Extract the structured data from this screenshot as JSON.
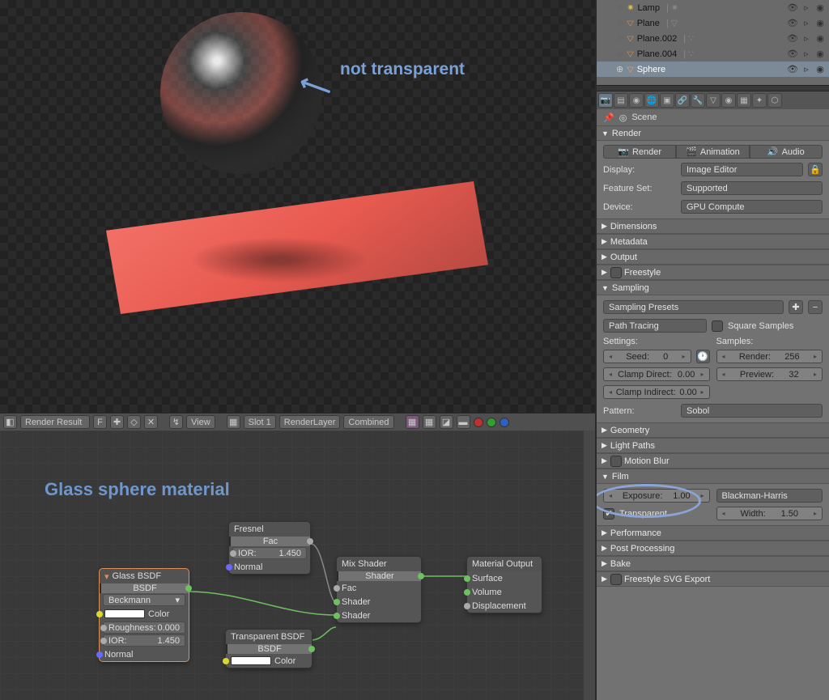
{
  "annotations": {
    "not_transparent": "not transparent",
    "material_title": "Glass sphere material"
  },
  "outliner": {
    "items": [
      {
        "name": "Lamp",
        "icon": "lamp"
      },
      {
        "name": "Plane",
        "icon": "mesh"
      },
      {
        "name": "Plane.002",
        "icon": "mesh"
      },
      {
        "name": "Plane.004",
        "icon": "mesh"
      },
      {
        "name": "Sphere",
        "icon": "mesh",
        "selected": true
      }
    ]
  },
  "image_header": {
    "result": "Render Result",
    "result_key": "F",
    "view": "View",
    "slot": "Slot 1",
    "layer": "RenderLayer",
    "pass": "Combined"
  },
  "nodes": {
    "glass": {
      "title": "Glass BSDF",
      "out": "BSDF",
      "dist": "Beckmann",
      "color": "Color",
      "rough_l": "Roughness:",
      "rough_v": "0.000",
      "ior_l": "IOR:",
      "ior_v": "1.450",
      "normal": "Normal"
    },
    "fresnel": {
      "title": "Fresnel",
      "out": "Fac",
      "ior_l": "IOR:",
      "ior_v": "1.450",
      "normal": "Normal"
    },
    "transp": {
      "title": "Transparent BSDF",
      "out": "BSDF",
      "color": "Color"
    },
    "mix": {
      "title": "Mix Shader",
      "out": "Shader",
      "fac": "Fac",
      "sh1": "Shader",
      "sh2": "Shader"
    },
    "mat": {
      "title": "Material Output",
      "surf": "Surface",
      "vol": "Volume",
      "disp": "Displacement"
    }
  },
  "props": {
    "crumb": "Scene",
    "render": {
      "title": "Render",
      "render": "Render",
      "anim": "Animation",
      "audio": "Audio",
      "display_l": "Display:",
      "display_v": "Image Editor",
      "feat_l": "Feature Set:",
      "feat_v": "Supported",
      "dev_l": "Device:",
      "dev_v": "GPU Compute"
    },
    "collapsed": [
      "Dimensions",
      "Metadata",
      "Output",
      "Freestyle"
    ],
    "sampling": {
      "title": "Sampling",
      "presets": "Sampling Presets",
      "integrator": "Path Tracing",
      "square": "Square Samples",
      "settings": "Settings:",
      "samples": "Samples:",
      "seed_l": "Seed:",
      "seed_v": "0",
      "render_l": "Render:",
      "render_v": "256",
      "cd_l": "Clamp Direct:",
      "cd_v": "0.00",
      "prev_l": "Preview:",
      "prev_v": "32",
      "ci_l": "Clamp Indirect:",
      "ci_v": "0.00",
      "pattern_l": "Pattern:",
      "pattern_v": "Sobol"
    },
    "collapsed2": [
      "Geometry",
      "Light Paths",
      "Motion Blur"
    ],
    "film": {
      "title": "Film",
      "exp_l": "Exposure:",
      "exp_v": "1.00",
      "filt": "Blackman-Harris",
      "trans": "Transparent",
      "width_l": "Width:",
      "width_v": "1.50"
    },
    "collapsed3": [
      "Performance",
      "Post Processing",
      "Bake",
      "Freestyle SVG Export"
    ]
  }
}
